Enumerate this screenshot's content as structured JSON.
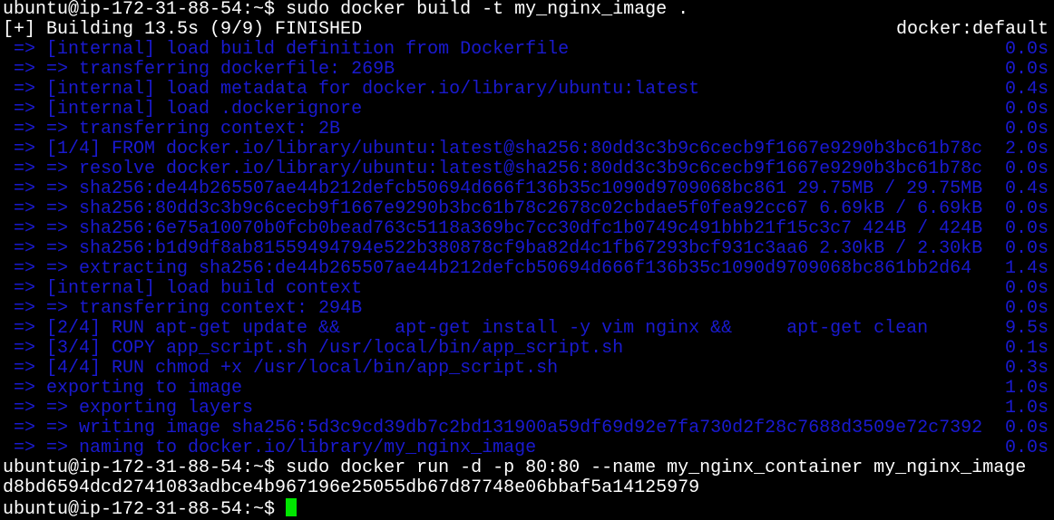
{
  "colors": {
    "background": "#000000",
    "text": "#ffffff",
    "build_output": "#1a1ad0",
    "cursor": "#00e600"
  },
  "prompt": "ubuntu@ip-172-31-88-54:~$ ",
  "commands": {
    "build": "sudo docker build -t my_nginx_image .",
    "run": "sudo docker run -d -p 80:80 --name my_nginx_container my_nginx_image"
  },
  "build_header": {
    "status": "[+] Building 13.5s (9/9) FINISHED",
    "builder": "docker:default"
  },
  "build_steps": [
    {
      "text": " => [internal] load build definition from Dockerfile",
      "time": "0.0s"
    },
    {
      "text": " => => transferring dockerfile: 269B",
      "time": "0.0s"
    },
    {
      "text": " => [internal] load metadata for docker.io/library/ubuntu:latest",
      "time": "0.4s"
    },
    {
      "text": " => [internal] load .dockerignore",
      "time": "0.0s"
    },
    {
      "text": " => => transferring context: 2B",
      "time": "0.0s"
    },
    {
      "text": " => [1/4] FROM docker.io/library/ubuntu:latest@sha256:80dd3c3b9c6cecb9f1667e9290b3bc61b78c",
      "time": "2.0s"
    },
    {
      "text": " => => resolve docker.io/library/ubuntu:latest@sha256:80dd3c3b9c6cecb9f1667e9290b3bc61b78c",
      "time": "0.0s"
    },
    {
      "text": " => => sha256:de44b265507ae44b212defcb50694d666f136b35c1090d9709068bc861 29.75MB / 29.75MB",
      "time": "0.4s"
    },
    {
      "text": " => => sha256:80dd3c3b9c6cecb9f1667e9290b3bc61b78c2678c02cbdae5f0fea92cc67 6.69kB / 6.69kB",
      "time": "0.0s"
    },
    {
      "text": " => => sha256:6e75a10070b0fcb0bead763c5118a369bc7cc30dfc1b0749c491bbb21f15c3c7 424B / 424B",
      "time": "0.0s"
    },
    {
      "text": " => => sha256:b1d9df8ab81559494794e522b380878cf9ba82d4c1fb67293bcf931c3aa6 2.30kB / 2.30kB",
      "time": "0.0s"
    },
    {
      "text": " => => extracting sha256:de44b265507ae44b212defcb50694d666f136b35c1090d9709068bc861bb2d64",
      "time": "1.4s"
    },
    {
      "text": " => [internal] load build context",
      "time": "0.0s"
    },
    {
      "text": " => => transferring context: 294B",
      "time": "0.0s"
    },
    {
      "text": " => [2/4] RUN apt-get update &&     apt-get install -y vim nginx &&     apt-get clean",
      "time": "9.5s"
    },
    {
      "text": " => [3/4] COPY app_script.sh /usr/local/bin/app_script.sh",
      "time": "0.1s"
    },
    {
      "text": " => [4/4] RUN chmod +x /usr/local/bin/app_script.sh",
      "time": "0.3s"
    },
    {
      "text": " => exporting to image",
      "time": "1.0s"
    },
    {
      "text": " => => exporting layers",
      "time": "1.0s"
    },
    {
      "text": " => => writing image sha256:5d3c9cd39db7c2bd131900a59df69d92e7fa730d2f28c7688d3509e72c7392",
      "time": "0.0s"
    },
    {
      "text": " => => naming to docker.io/library/my_nginx_image",
      "time": "0.0s"
    }
  ],
  "container_id": "d8bd6594dcd2741083adbce4b967196e25055db67d87748e06bbaf5a14125979"
}
